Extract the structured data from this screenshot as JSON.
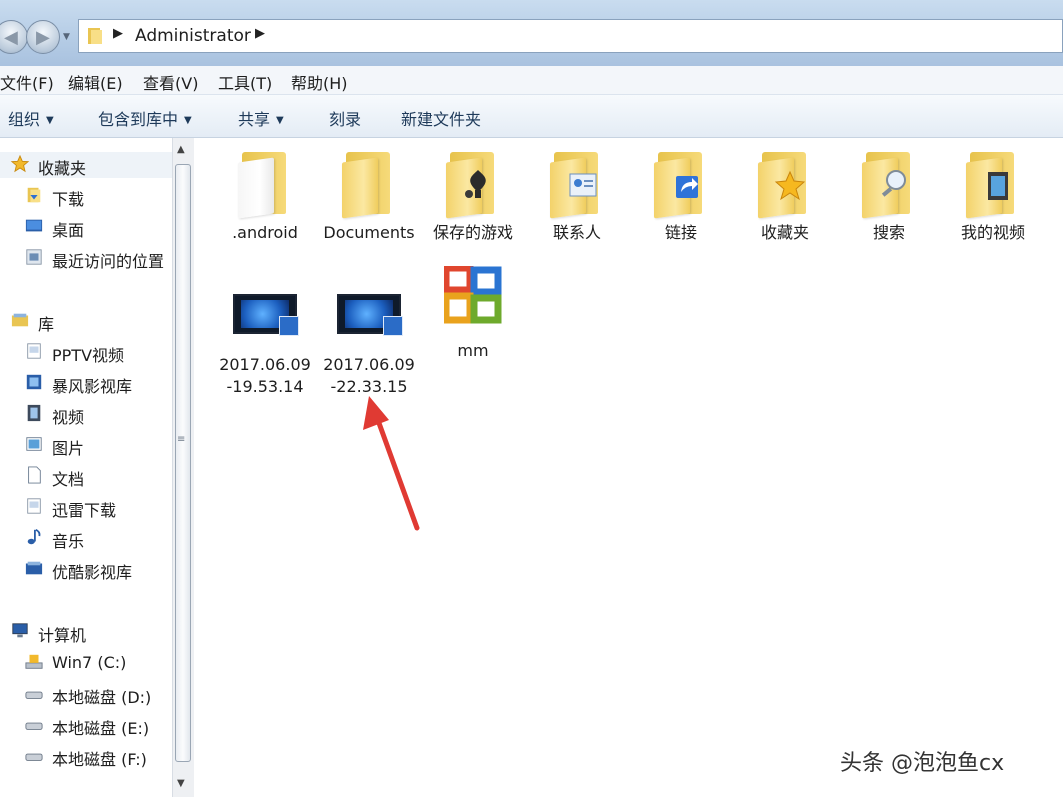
{
  "address": {
    "crumb": "Administrator"
  },
  "menu": [
    "文件(F)",
    "编辑(E)",
    "查看(V)",
    "工具(T)",
    "帮助(H)"
  ],
  "commands": [
    {
      "label": "组织",
      "dropdown": true
    },
    {
      "label": "包含到库中",
      "dropdown": true
    },
    {
      "label": "共享",
      "dropdown": true
    },
    {
      "label": "刻录",
      "dropdown": false
    },
    {
      "label": "新建文件夹",
      "dropdown": false
    }
  ],
  "nav": {
    "favorites": {
      "label": "收藏夹",
      "items": [
        "下载",
        "桌面",
        "最近访问的位置"
      ]
    },
    "libraries": {
      "label": "库",
      "items": [
        "PPTV视频",
        "暴风影视库",
        "视频",
        "图片",
        "文档",
        "迅雷下载",
        "音乐",
        "优酷影视库"
      ]
    },
    "computer": {
      "label": "计算机",
      "items": [
        "Win7 (C:)",
        "本地磁盘 (D:)",
        "本地磁盘 (E:)",
        "本地磁盘 (F:)"
      ]
    }
  },
  "files": [
    {
      "name": ".android",
      "icon": "folder-icon"
    },
    {
      "name": "Documents",
      "icon": "folder-icon"
    },
    {
      "name": "保存的游戏",
      "icon": "saved-games-folder-icon"
    },
    {
      "name": "联系人",
      "icon": "contacts-folder-icon"
    },
    {
      "name": "链接",
      "icon": "links-folder-icon"
    },
    {
      "name": "收藏夹",
      "icon": "favorites-folder-icon"
    },
    {
      "name": "搜索",
      "icon": "searches-folder-icon"
    },
    {
      "name": "我的视频",
      "icon": "videos-folder-icon"
    },
    {
      "name": "2017.06.09-19.53.14",
      "icon": "video-file-icon"
    },
    {
      "name": "2017.06.09-22.33.15",
      "icon": "video-file-icon"
    },
    {
      "name": "mm",
      "icon": "office-file-icon"
    }
  ],
  "watermark": "头条 @泡泡鱼cx",
  "colors": {
    "accent": "#1e3a5a",
    "annotation_arrow": "#e03a33",
    "folder": "#f3d26a"
  }
}
